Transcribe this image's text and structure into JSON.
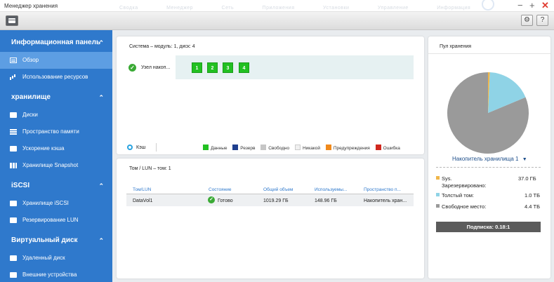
{
  "window": {
    "title": "Менеджер хранения",
    "ghost_tabs": [
      "Сводка",
      "Менеджер",
      "Сеть",
      "Приложения",
      "Установки",
      "Управление",
      "Информация"
    ]
  },
  "sidebar": {
    "sections": [
      {
        "label": "Информационная панель",
        "items": [
          {
            "label": "Обзор",
            "icon": "overview-icon",
            "active": true
          },
          {
            "label": "Использование ресурсов",
            "icon": "resource-usage-icon"
          }
        ]
      },
      {
        "label": "хранилище",
        "items": [
          {
            "label": "Диски",
            "icon": "disk-icon"
          },
          {
            "label": "Пространство памяти",
            "icon": "storage-space-icon"
          },
          {
            "label": "Ускорение кэша",
            "icon": "cache-icon"
          },
          {
            "label": "Хранилище Snapshot",
            "icon": "snapshot-icon"
          }
        ]
      },
      {
        "label": "iSCSI",
        "items": [
          {
            "label": "Хранилище iSCSI",
            "icon": "iscsi-storage-icon"
          },
          {
            "label": "Резервирование LUN",
            "icon": "lun-backup-icon"
          }
        ]
      },
      {
        "label": "Виртуальный диск",
        "items": [
          {
            "label": "Удаленный диск",
            "icon": "remote-disk-icon"
          },
          {
            "label": "Внешние устройства",
            "icon": "external-device-icon"
          }
        ]
      }
    ]
  },
  "system": {
    "title": "Система – модуль: 1, диск: 4",
    "node_label": "Узел накоп...",
    "disks": [
      "1",
      "2",
      "3",
      "4"
    ],
    "cache_label": "Кэш",
    "legend": [
      {
        "label": "Данные",
        "color": "#22c022"
      },
      {
        "label": "Резерв",
        "color": "#1f3f8f"
      },
      {
        "label": "Свободно",
        "color": "#c6c6c6"
      },
      {
        "label": "Никакой",
        "color": "#f0f0f0"
      },
      {
        "label": "Предупреждения",
        "color": "#f08a1c"
      },
      {
        "label": "Ошибка",
        "color": "#d0281e"
      }
    ]
  },
  "volume": {
    "title": "Том / LUN – том: 1",
    "columns": [
      "Том/LUN",
      "Состояние",
      "Общий объем",
      "Используемы...",
      "Пространство п..."
    ],
    "rows": [
      {
        "name": "DataVol1",
        "status": "Готово",
        "total": "1019.29 ГБ",
        "used": "148.96 ГБ",
        "pool": "Накопитель хран..."
      }
    ]
  },
  "pool": {
    "title": "Пул хранения",
    "selector": "Накопитель хранилища 1",
    "stats": [
      {
        "label": "Sys. Зарезервировано:",
        "value": "37.0 ГБ",
        "color": "#f0b64a"
      },
      {
        "label": "Толстый том:",
        "value": "1.0 ТБ",
        "color": "#8fd3e6"
      },
      {
        "label": "Свободное место:",
        "value": "4.4 ТБ",
        "color": "#9a9a9a"
      }
    ],
    "subscription": "Подписка: 0.18:1",
    "slice_fractions": {
      "reserved": 0.007,
      "thick": 0.18,
      "free": 0.813
    }
  }
}
